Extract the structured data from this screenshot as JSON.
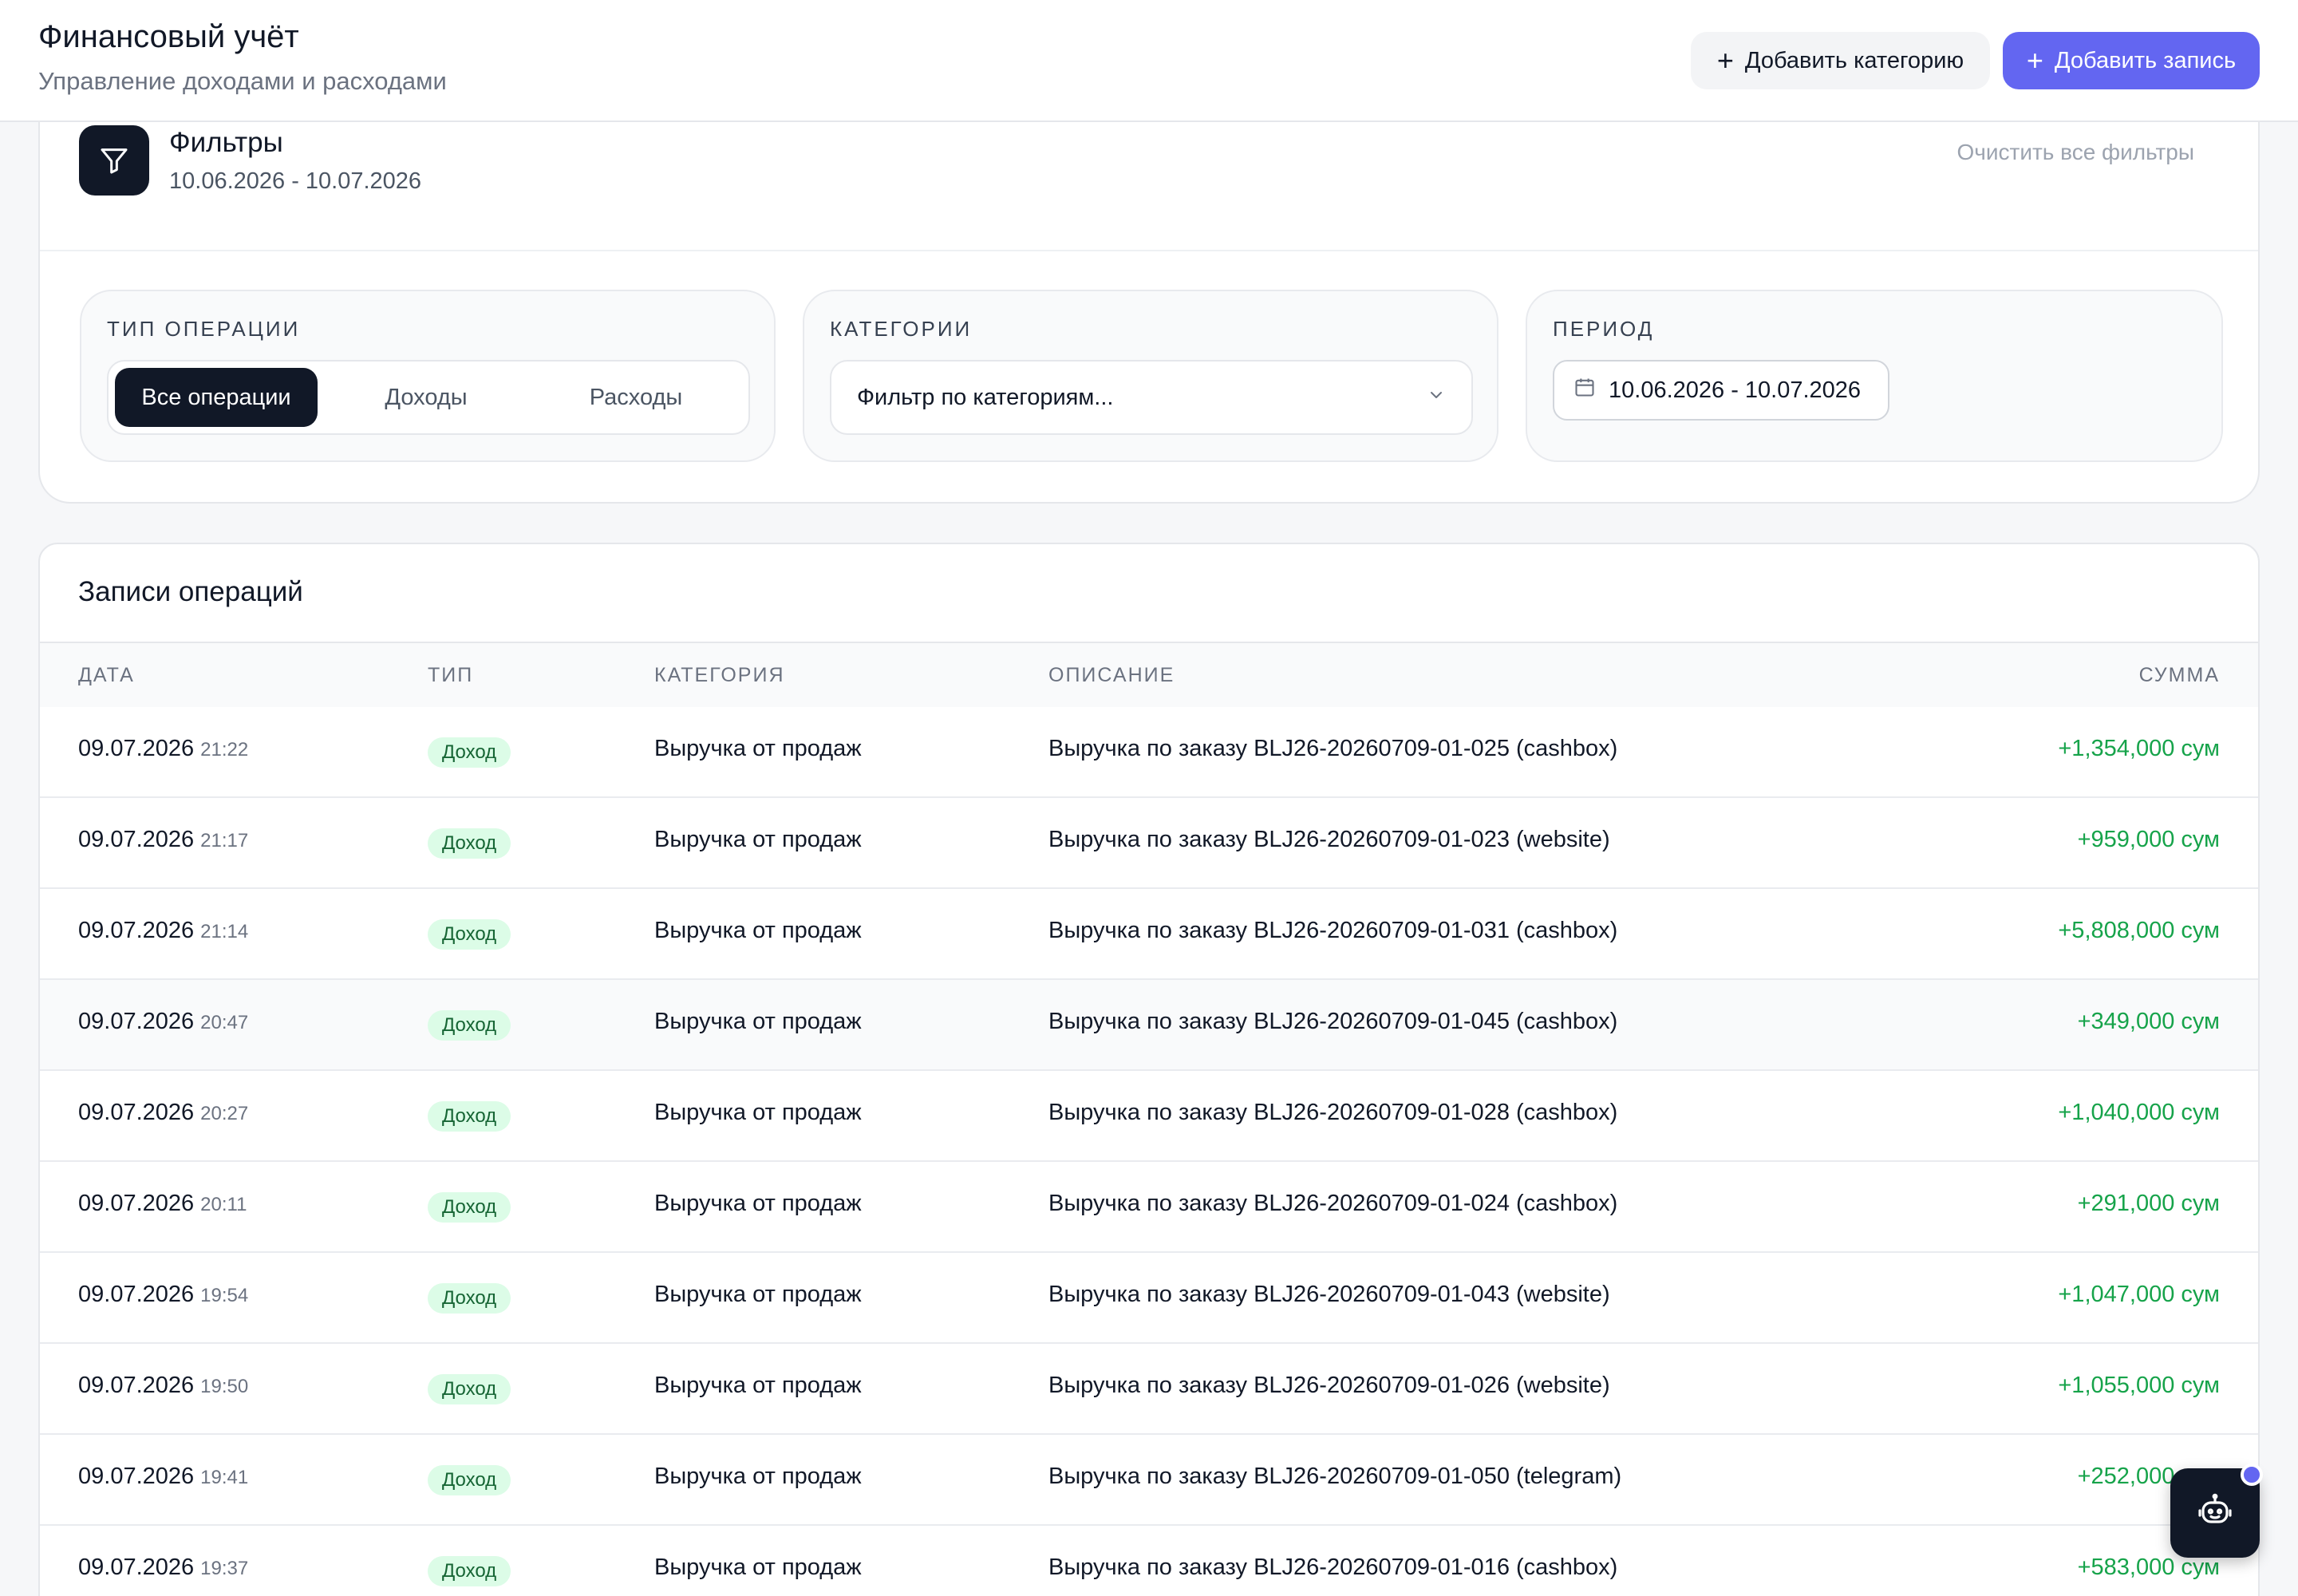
{
  "header": {
    "title": "Финансовый учёт",
    "subtitle": "Управление доходами и расходами",
    "add_category_label": "Добавить категорию",
    "add_record_label": "Добавить запись"
  },
  "filters": {
    "title": "Фильтры",
    "date_range": "10.06.2026 - 10.07.2026",
    "clear_label": "Очистить все фильтры",
    "operation_type": {
      "label": "Тип операции",
      "options": [
        "Все операции",
        "Доходы",
        "Расходы"
      ],
      "selected": "Все операции"
    },
    "categories": {
      "label": "Категории",
      "placeholder": "Фильтр по категориям..."
    },
    "period": {
      "label": "Период",
      "value": "10.06.2026 - 10.07.2026"
    }
  },
  "records": {
    "title": "Записи операций",
    "columns": [
      "Дата",
      "Тип",
      "Категория",
      "Описание",
      "Сумма"
    ],
    "rows": [
      {
        "date": "09.07.2026",
        "time": "21:22",
        "type": "Доход",
        "category": "Выручка от продаж",
        "description": "Выручка по заказу BLJ26-20260709-01-025 (cashbox)",
        "amount": "+1,354,000 сум"
      },
      {
        "date": "09.07.2026",
        "time": "21:17",
        "type": "Доход",
        "category": "Выручка от продаж",
        "description": "Выручка по заказу BLJ26-20260709-01-023 (website)",
        "amount": "+959,000 сум"
      },
      {
        "date": "09.07.2026",
        "time": "21:14",
        "type": "Доход",
        "category": "Выручка от продаж",
        "description": "Выручка по заказу BLJ26-20260709-01-031 (cashbox)",
        "amount": "+5,808,000 сум"
      },
      {
        "date": "09.07.2026",
        "time": "20:47",
        "type": "Доход",
        "category": "Выручка от продаж",
        "description": "Выручка по заказу BLJ26-20260709-01-045 (cashbox)",
        "amount": "+349,000 сум"
      },
      {
        "date": "09.07.2026",
        "time": "20:27",
        "type": "Доход",
        "category": "Выручка от продаж",
        "description": "Выручка по заказу BLJ26-20260709-01-028 (cashbox)",
        "amount": "+1,040,000 сум"
      },
      {
        "date": "09.07.2026",
        "time": "20:11",
        "type": "Доход",
        "category": "Выручка от продаж",
        "description": "Выручка по заказу BLJ26-20260709-01-024 (cashbox)",
        "amount": "+291,000 сум"
      },
      {
        "date": "09.07.2026",
        "time": "19:54",
        "type": "Доход",
        "category": "Выручка от продаж",
        "description": "Выручка по заказу BLJ26-20260709-01-043 (website)",
        "amount": "+1,047,000 сум"
      },
      {
        "date": "09.07.2026",
        "time": "19:50",
        "type": "Доход",
        "category": "Выручка от продаж",
        "description": "Выручка по заказу BLJ26-20260709-01-026 (website)",
        "amount": "+1,055,000 сум"
      },
      {
        "date": "09.07.2026",
        "time": "19:41",
        "type": "Доход",
        "category": "Выручка от продаж",
        "description": "Выручка по заказу BLJ26-20260709-01-050 (telegram)",
        "amount": "+252,000 сум"
      },
      {
        "date": "09.07.2026",
        "time": "19:37",
        "type": "Доход",
        "category": "Выручка от продаж",
        "description": "Выручка по заказу BLJ26-20260709-01-016 (cashbox)",
        "amount": "+583,000 сум"
      }
    ]
  },
  "icons": {
    "filter": "filter-icon",
    "plus": "plus-icon",
    "chevron": "chevron-down-icon",
    "calendar": "calendar-icon",
    "assistant": "robot-icon"
  },
  "colors": {
    "primary": "#6366f1",
    "dark": "#111827",
    "income": "#16a34a",
    "badge_bg": "#dcfce7"
  }
}
